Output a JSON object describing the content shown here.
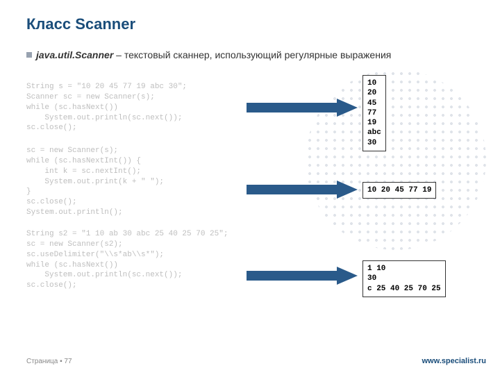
{
  "title": "Класс Scanner",
  "description": {
    "bold": "java.util.Scanner",
    "rest": " –  текстовый сканнер, использующий регулярные выражения"
  },
  "code1": "String s = \"10 20 45 77 19 abc 30\";\nScanner sc = new Scanner(s);\nwhile (sc.hasNext())\n    System.out.println(sc.next());\nsc.close();",
  "code2": "sc = new Scanner(s);\nwhile (sc.hasNextInt()) {\n    int k = sc.nextInt();\n    System.out.print(k + \" \");\n}\nsc.close();\nSystem.out.println();",
  "code3": "String s2 = \"1 10 ab 30 abc 25 40 25 70 25\";\nsc = new Scanner(s2);\nsc.useDelimiter(\"\\\\s*ab\\\\s*\");\nwhile (sc.hasNext())\n    System.out.println(sc.next());\nsc.close();",
  "output1": "10\n20\n45\n77\n19\nabc\n30",
  "output2": "10 20 45 77 19",
  "output3": "1 10\n30\nc 25 40 25 70 25",
  "footer": {
    "page": "Страница ▪ 77",
    "site": "www.specialist.ru"
  }
}
